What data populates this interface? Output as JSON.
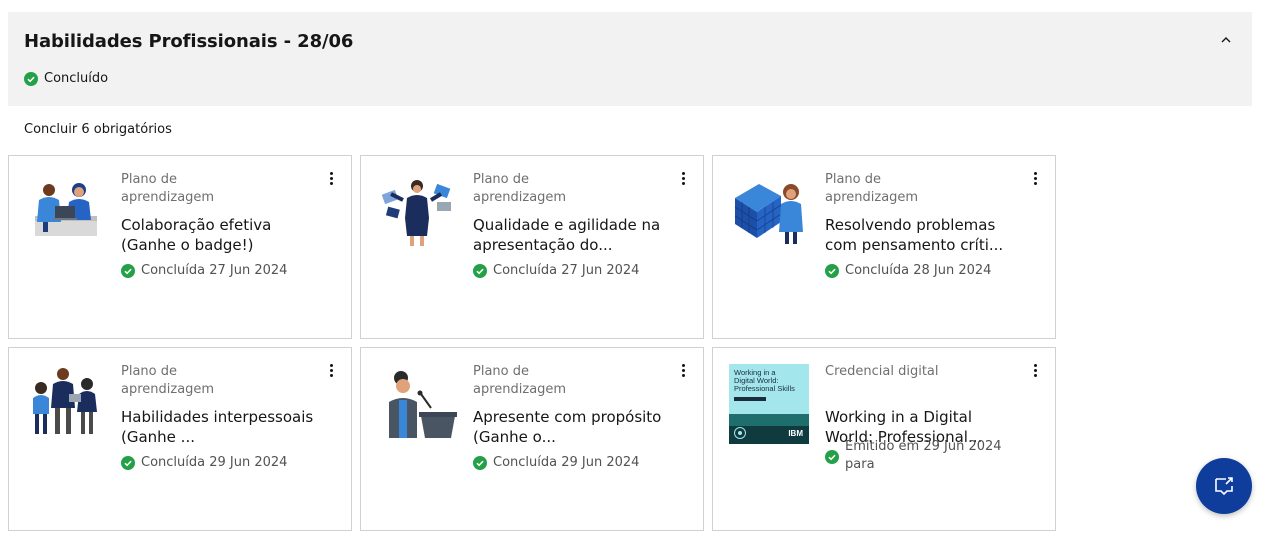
{
  "section": {
    "title": "Habilidades Profissionais - 28/06",
    "status": "Concluído"
  },
  "requirement_text": "Concluir 6 obrigatórios",
  "cards": [
    {
      "type": "Plano de aprendizagem",
      "title": "Colaboração efetiva (Ganhe o badge!)",
      "status": "Concluída 27 Jun 2024",
      "icon": "collaboration-illustration"
    },
    {
      "type": "Plano de aprendizagem",
      "title": "Qualidade e agilidade na apresentação do...",
      "status": "Concluída 27 Jun 2024",
      "icon": "presentation-agility-illustration"
    },
    {
      "type": "Plano de aprendizagem",
      "title": "Resolvendo problemas com pensamento críti...",
      "status": "Concluída 28 Jun 2024",
      "icon": "problem-solving-illustration"
    },
    {
      "type": "Plano de aprendizagem",
      "title": "Habilidades interpessoais (Ganhe ...",
      "status": "Concluída 29 Jun 2024",
      "icon": "interpersonal-illustration"
    },
    {
      "type": "Plano de aprendizagem",
      "title": "Apresente com propósito (Ganhe o...",
      "status": "Concluída 29 Jun 2024",
      "icon": "speaker-illustration"
    },
    {
      "type": "Credencial digital",
      "title": "Working in a Digital World: Professional...",
      "status": "Emitido em 29 Jun 2024 para",
      "icon": "credential-badge-image",
      "badge": {
        "line1": "Working in a",
        "line2": "Digital World:",
        "line3": "Professional Skills",
        "brand": "IBM"
      }
    }
  ],
  "colors": {
    "success": "#24a148",
    "fab": "#0f3d9c",
    "header_bg": "#f2f2f2",
    "card_border": "#d0d0d0"
  }
}
